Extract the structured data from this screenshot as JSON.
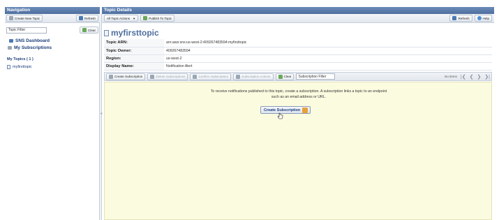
{
  "navigation": {
    "header": "Navigation",
    "create_new_topic_label": "Create New Topic",
    "refresh_label": "Refresh",
    "topic_filter_value": "Topic Filter",
    "clear_label": "Clear",
    "links": [
      {
        "label": "SNS Dashboard",
        "icon": "dashboard-icon"
      },
      {
        "label": "My Subscriptions",
        "icon": "subscriptions-icon"
      }
    ],
    "my_topics_label": "My Topics ( 1 )",
    "topics": [
      {
        "label": "myfirsttopic",
        "icon": "topic-icon"
      }
    ]
  },
  "topic_details": {
    "header": "Topic Details",
    "all_topic_actions_label": "All Topic Actions",
    "publish_label": "Publish To Topic",
    "refresh_label": "Refresh",
    "help_label": "Help",
    "title": "myfirsttopic",
    "attributes": [
      {
        "key": "Topic ARN:",
        "value": "arn:aws:sns:us-west-2:409267483594:myfirsttopic"
      },
      {
        "key": "Topic Owner:",
        "value": "409267483594"
      },
      {
        "key": "Region:",
        "value": "us-west-2"
      },
      {
        "key": "Display Name:",
        "value": "Notification Alert"
      }
    ],
    "subscription_toolbar": {
      "create_subscription_label": "Create Subscription",
      "delete_subscriptions_label": "Delete Subscriptions",
      "confirm_label": "Confirm Subscription",
      "subscription_actions_label": "Subscription Actions",
      "clear_label": "Clear",
      "filter_value": "Subscription Filter",
      "pager_text": "No items"
    },
    "empty_message": "To receive notifications published to this topic, create a subscription. A subscription links a topic to an endpoint such as an email address or URL.",
    "create_subscription_button": "Create Subscription"
  },
  "colors": {
    "header_blue": "#4f6f9f",
    "empty_area_bg": "#fbfbe0",
    "link_blue": "#1b3d7a"
  }
}
